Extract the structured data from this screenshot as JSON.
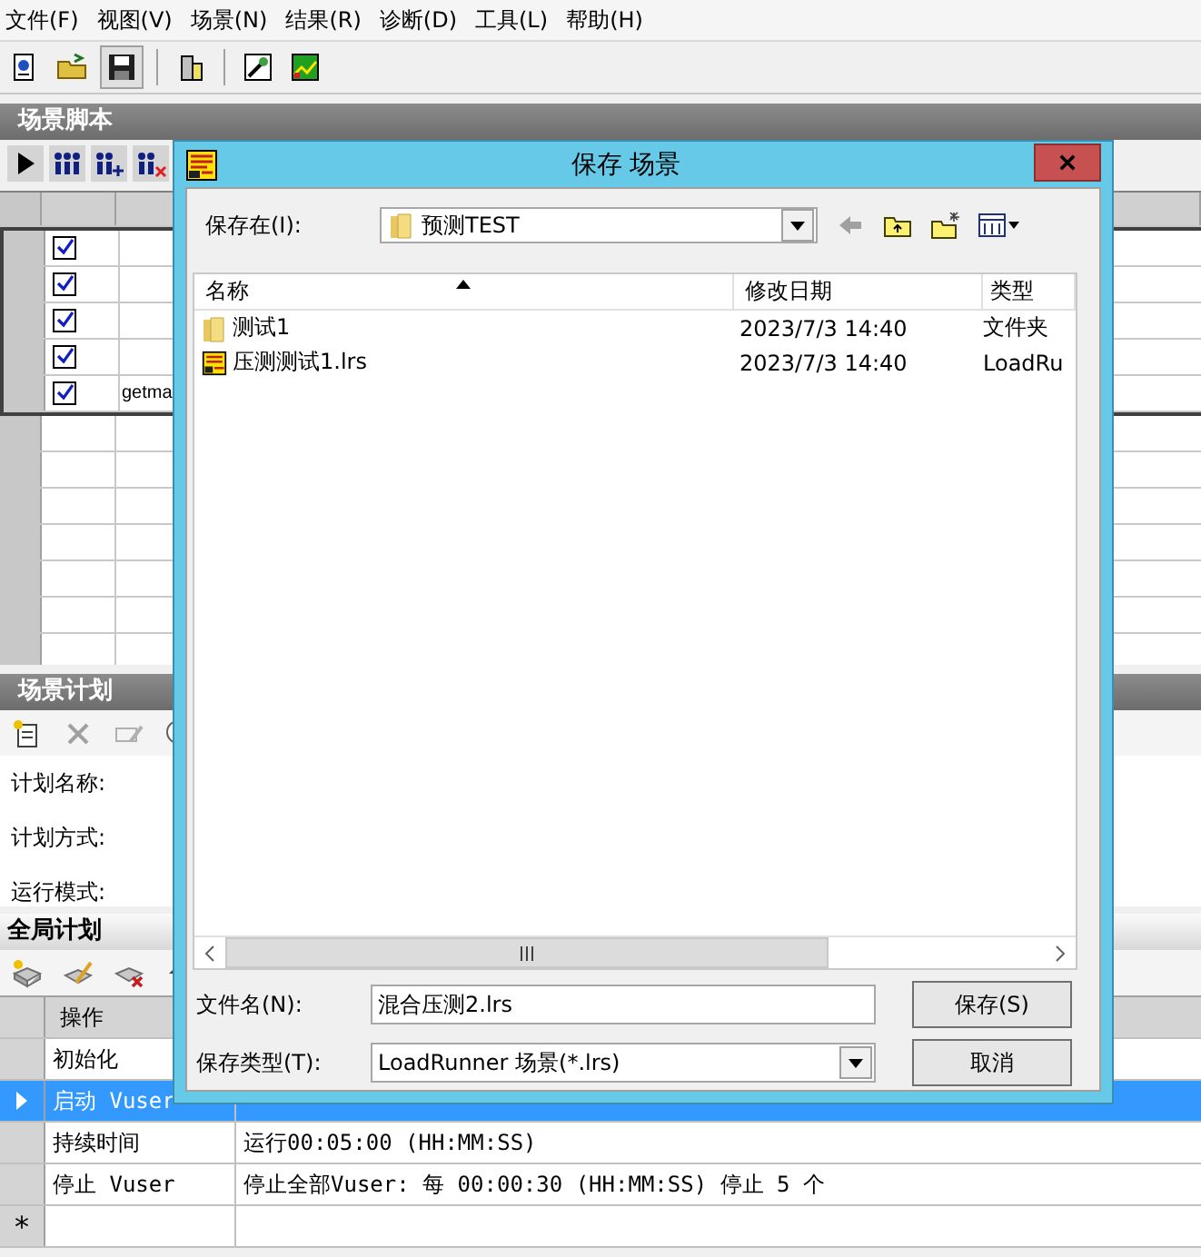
{
  "menu": [
    "文件(F)",
    "视图(V)",
    "场景(N)",
    "结果(R)",
    "诊断(D)",
    "工具(L)",
    "帮助(H)"
  ],
  "script_panel": {
    "title": "场景脚本",
    "rows": [
      {
        "checked": true
      },
      {
        "checked": true
      },
      {
        "checked": true
      },
      {
        "checked": true
      },
      {
        "checked": true,
        "name": "getma"
      }
    ]
  },
  "schedule_panel": {
    "title": "场景计划",
    "fields": [
      "计划名称:",
      "计划方式:",
      "运行模式:"
    ]
  },
  "global_schedule": {
    "title": "全局计划",
    "column": "操作",
    "rows": [
      {
        "action": "初始化",
        "selected": false
      },
      {
        "action": "启动 Vuser",
        "selected": true
      },
      {
        "action": "持续时间",
        "detail": "运行00:05:00 (HH:MM:SS)",
        "selected": false
      },
      {
        "action": "停止 Vuser",
        "detail": "停止全部Vuser: 每 00:00:30 (HH:MM:SS) 停止 5 个",
        "selected": false
      }
    ],
    "new_row_marker": "*"
  },
  "dialog": {
    "title": "保存 场景",
    "save_in_label": "保存在(I):",
    "save_in": "预测TEST",
    "columns": [
      "名称",
      "修改日期",
      "类型"
    ],
    "files": [
      {
        "kind": "folder",
        "name": "测试1",
        "modified": "2023/7/3 14:40",
        "type": "文件夹"
      },
      {
        "kind": "scenario",
        "name": "压测测试1.lrs",
        "modified": "2023/7/3 14:40",
        "type": "LoadRu"
      }
    ],
    "filename_label": "文件名(N):",
    "filename": "混合压测2.lrs",
    "filetype_label": "保存类型(T):",
    "filetype": "LoadRunner 场景(*.lrs)",
    "buttons": [
      "保存(S)",
      "取消"
    ]
  }
}
